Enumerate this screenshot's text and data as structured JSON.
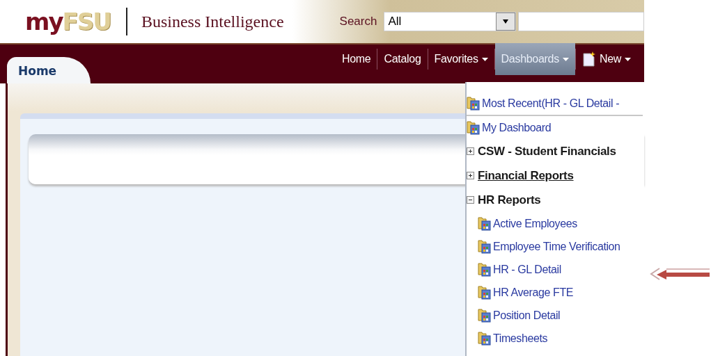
{
  "header": {
    "logo": {
      "part_1": "my",
      "part_2": "FSU"
    },
    "title": "Business Intelligence",
    "search": {
      "label": "Search",
      "scope": "All"
    }
  },
  "tabs": [
    {
      "label": "Home",
      "selected": true
    }
  ],
  "nav": [
    {
      "label": "Home",
      "kind": "link",
      "selected": false
    },
    {
      "label": "Catalog",
      "kind": "link",
      "selected": false
    },
    {
      "label": "Favorites",
      "kind": "menu",
      "selected": false
    },
    {
      "label": "Dashboards",
      "kind": "menu",
      "selected": true
    },
    {
      "label": "New",
      "kind": "new",
      "selected": false
    }
  ],
  "dashboards_menu": {
    "items": [
      {
        "kind": "dashboard",
        "label": "Most Recent(HR - GL Detail -"
      },
      {
        "kind": "separator"
      },
      {
        "kind": "dashboard",
        "label": "My Dashboard"
      },
      {
        "kind": "group",
        "label": "CSW - Student Financials",
        "expanded": false,
        "hovered": false
      },
      {
        "kind": "group",
        "label": "Financial Reports",
        "expanded": false,
        "hovered": true
      },
      {
        "kind": "group",
        "label": "HR Reports",
        "expanded": true,
        "hovered": false,
        "children": [
          {
            "kind": "dashboard",
            "label": "Active Employees"
          },
          {
            "kind": "dashboard",
            "label": "Employee Time Verification"
          },
          {
            "kind": "dashboard",
            "label": "HR - GL Detail"
          },
          {
            "kind": "dashboard",
            "label": "HR Average FTE"
          },
          {
            "kind": "dashboard",
            "label": "Position Detail"
          },
          {
            "kind": "dashboard",
            "label": "Timesheets"
          }
        ]
      }
    ]
  }
}
